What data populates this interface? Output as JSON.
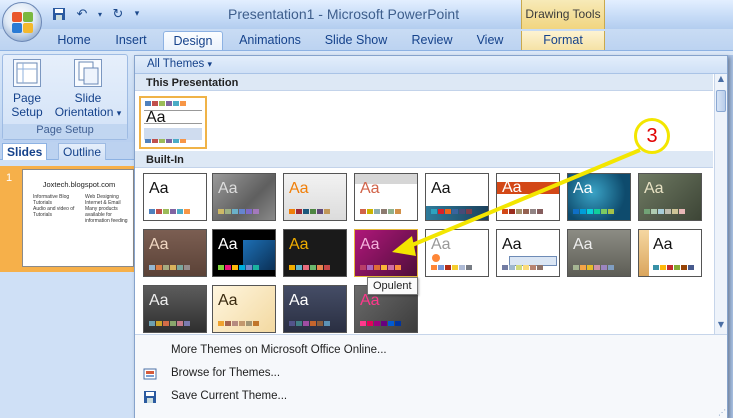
{
  "window": {
    "title": "Presentation1 - Microsoft PowerPoint",
    "contextual_group": "Drawing Tools"
  },
  "qat": {
    "save_icon": "save-icon",
    "undo_icon": "undo-icon",
    "redo_icon": "redo-icon",
    "customize_icon": "chevron-down-icon"
  },
  "tabs": [
    "Home",
    "Insert",
    "Design",
    "Animations",
    "Slide Show",
    "Review",
    "View",
    "Format"
  ],
  "active_tab": "Design",
  "ribbon": {
    "page_setup_label": "Page\nSetup",
    "page_setup_1": "Page",
    "page_setup_2": "Setup",
    "orientation_1": "Slide",
    "orientation_2": "Orientation",
    "orientation_arrow": "▾",
    "group_label": "Page Setup"
  },
  "slides_panel": {
    "tab_slides": "Slides",
    "tab_outline": "Outline",
    "slide_number": "1",
    "thumb_title": "Joxtech.blogspot.com",
    "thumb_left": [
      "Informative Blog",
      "Tutorials",
      "Audio and video of",
      "Tutorials"
    ],
    "thumb_right": [
      "Web Designing",
      "Internet & Email",
      "Many products",
      "available for",
      "information feeding"
    ]
  },
  "gallery": {
    "header": "All Themes",
    "header_arrow": "▾",
    "section_this": "This Presentation",
    "section_builtin": "Built-In",
    "theme_text": "Aa",
    "tooltip": "Opulent",
    "footer": {
      "more_online": "More Themes on Microsoft Office Online...",
      "browse": "Browse for Themes...",
      "save": "Save Current Theme..."
    }
  },
  "annotation": {
    "step": "3",
    "colors": {
      "circle": "#f3e600",
      "number": "#e00000",
      "arrow": "#f3e600"
    }
  },
  "colors": {
    "ribbon_blue": "#c4d9f3",
    "selected_orange": "#f0b347",
    "title_text": "#3e5e8c"
  }
}
